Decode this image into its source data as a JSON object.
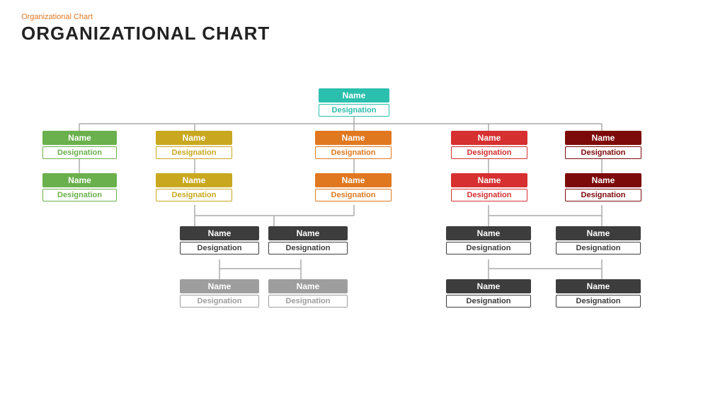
{
  "subtitle": "Organizational  Chart",
  "title": "ORGANIZATIONAL CHART",
  "nodes": {
    "root": {
      "name": "Name",
      "designation": "Designation"
    },
    "l1_1": {
      "name": "Name",
      "designation": "Designation"
    },
    "l1_2": {
      "name": "Name",
      "designation": "Designation"
    },
    "l1_3": {
      "name": "Name",
      "designation": "Designation"
    },
    "l1_4": {
      "name": "Name",
      "designation": "Designation"
    },
    "l1_5": {
      "name": "Name",
      "designation": "Designation"
    },
    "l2_1": {
      "name": "Name",
      "designation": "Designation"
    },
    "l2_2": {
      "name": "Name",
      "designation": "Designation"
    },
    "l2_3": {
      "name": "Name",
      "designation": "Designation"
    },
    "l2_4": {
      "name": "Name",
      "designation": "Designation"
    },
    "l2_5": {
      "name": "Name",
      "designation": "Designation"
    },
    "l3_1": {
      "name": "Name",
      "designation": "Designation"
    },
    "l3_2": {
      "name": "Name",
      "designation": "Designation"
    },
    "l3_3": {
      "name": "Name",
      "designation": "Designation"
    },
    "l3_4": {
      "name": "Name",
      "designation": "Designation"
    },
    "l4_1": {
      "name": "Name",
      "designation": "Designation"
    },
    "l4_2": {
      "name": "Name",
      "designation": "Designation"
    },
    "l4_3": {
      "name": "Name",
      "designation": "Designation"
    },
    "l4_4": {
      "name": "Name",
      "designation": "Designation"
    }
  }
}
